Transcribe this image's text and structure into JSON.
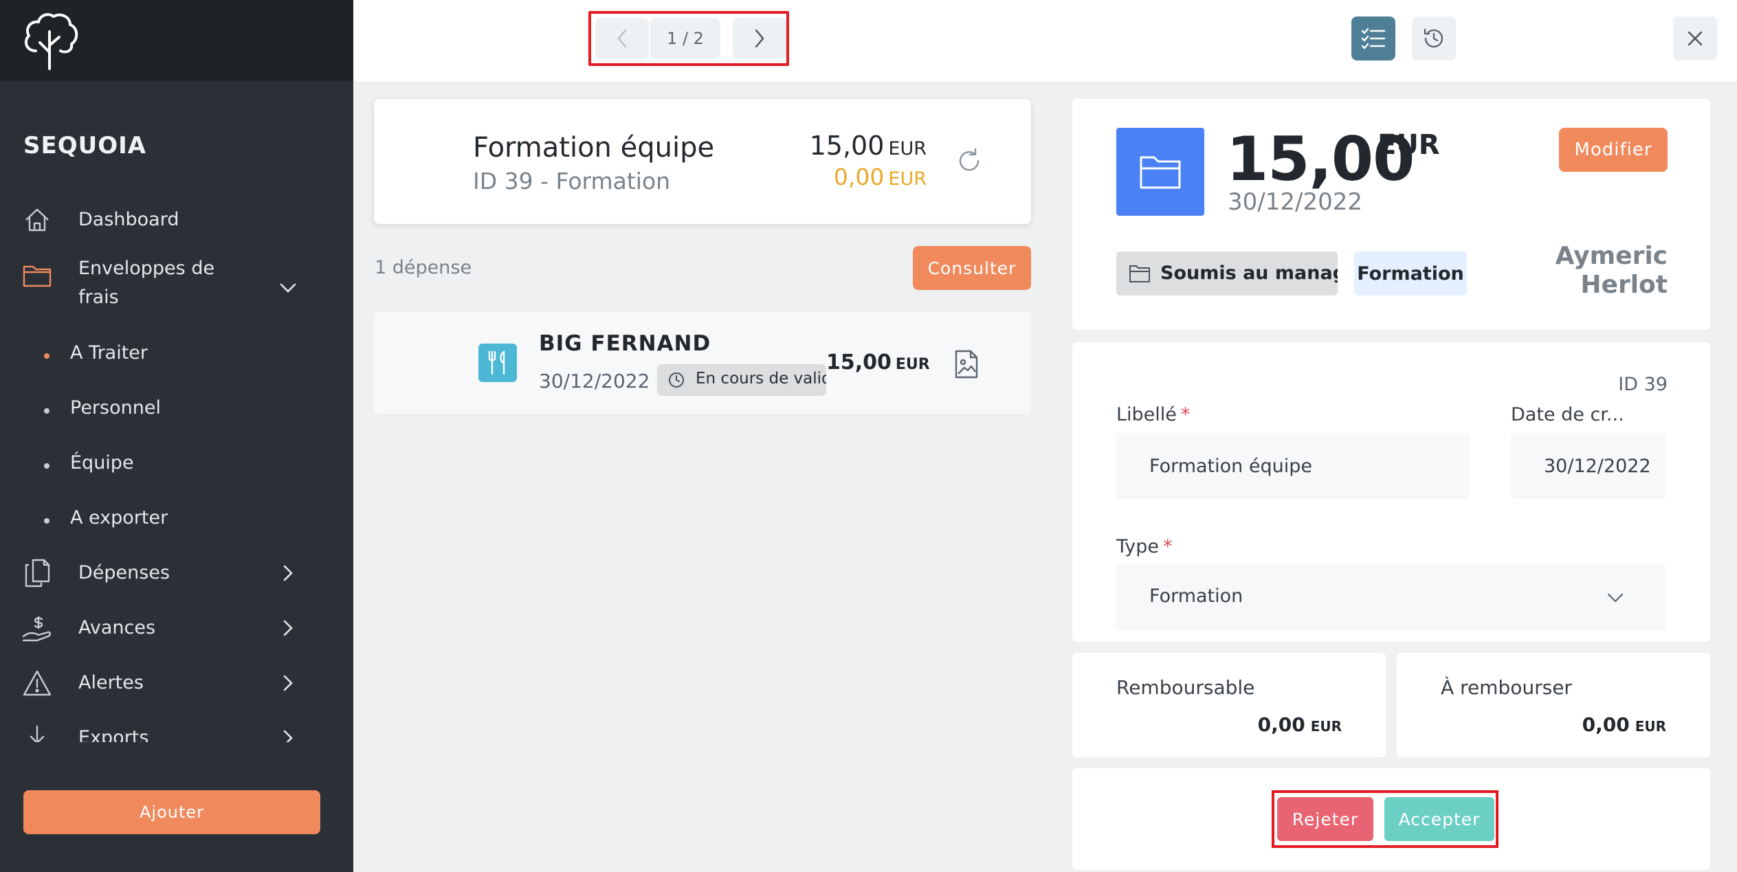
{
  "app": {
    "brand": "SEQUOIA",
    "logo_icon": "tree-icon"
  },
  "sidebar": {
    "items": [
      {
        "label": "Dashboard",
        "icon": "home-icon"
      },
      {
        "label": "Enveloppes de frais",
        "icon": "folder-icon",
        "expanded": true
      },
      {
        "label": "Dépenses",
        "icon": "documents-icon"
      },
      {
        "label": "Avances",
        "icon": "hand-coin-icon"
      },
      {
        "label": "Alertes",
        "icon": "warning-icon"
      },
      {
        "label": "Exports",
        "icon": "download-icon"
      }
    ],
    "subitems": [
      {
        "label": "A Traiter",
        "active": true
      },
      {
        "label": "Personnel",
        "active": false
      },
      {
        "label": "Équipe",
        "active": false
      },
      {
        "label": "A exporter",
        "active": false
      }
    ],
    "add_label": "Ajouter"
  },
  "topbar": {
    "pager": "1 / 2"
  },
  "summary": {
    "title": "Formation équipe",
    "subtitle": "ID 39 - Formation",
    "amount": "15,00",
    "amount_currency": "EUR",
    "amount2": "0,00",
    "amount2_currency": "EUR"
  },
  "expenses": {
    "count_label": "1 dépense",
    "consult_label": "Consulter",
    "items": [
      {
        "name": "BIG FERNAND",
        "date": "30/12/2022",
        "status": "En cours de validation",
        "amount": "15,00",
        "currency": "EUR",
        "icon": "cutlery-icon"
      }
    ]
  },
  "detail": {
    "amount": "15,00",
    "currency": "EUR",
    "date": "30/12/2022",
    "modify_label": "Modifier",
    "state": "Soumis au manager",
    "type_badge": "Formation",
    "person_first": "Aymeric",
    "person_last": "Herlot"
  },
  "form": {
    "id_label": "ID 39",
    "libelle_label": "Libellé",
    "libelle_value": "Formation équipe",
    "date_label": "Date de cr...",
    "date_value": "30/12/2022",
    "type_label": "Type",
    "type_value": "Formation",
    "required_mark": "*"
  },
  "totals": {
    "refundable_label": "Remboursable",
    "refundable_value": "0,00",
    "to_refund_label": "À rembourser",
    "to_refund_value": "0,00",
    "currency": "EUR"
  },
  "actions": {
    "reject_label": "Rejeter",
    "accept_label": "Accepter"
  },
  "colors": {
    "accent": "#f08a5d",
    "sidebar_bg": "#2b3036",
    "folder_blue": "#4a82f5",
    "reject": "#e86472",
    "accept": "#6ccfc4",
    "pending_amount": "#e9a82b",
    "highlight_box": "#e41b23"
  }
}
